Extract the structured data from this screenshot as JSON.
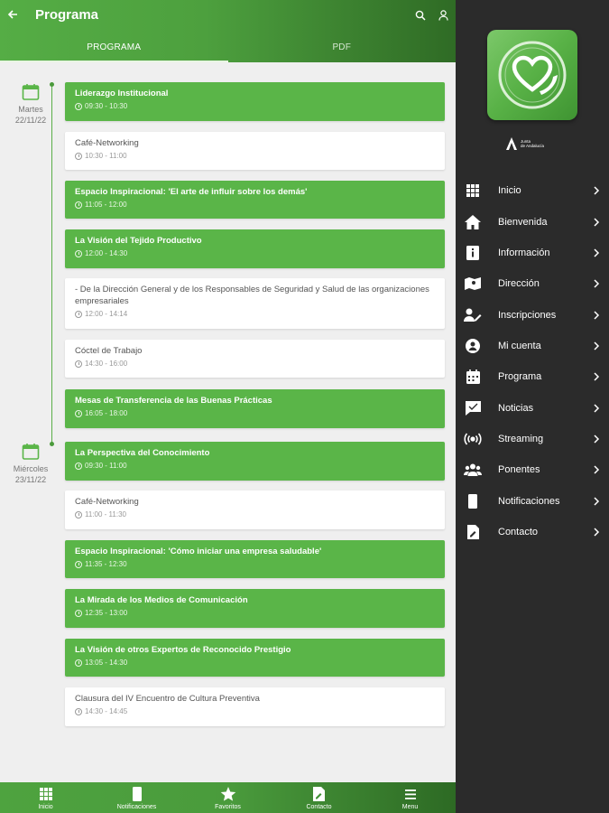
{
  "header": {
    "title": "Programa",
    "back_icon": "arrow-left-icon",
    "search_icon": "search-icon",
    "user_icon": "user-icon"
  },
  "tabs": [
    {
      "label": "PROGRAMA",
      "active": true
    },
    {
      "label": "PDF",
      "active": false
    }
  ],
  "days": [
    {
      "line1": "Martes",
      "line2": "22/11/22"
    },
    {
      "line1": "Miércoles",
      "line2": "23/11/22"
    }
  ],
  "events": [
    {
      "title": "Liderazgo Institucional",
      "time": "09:30 - 10:30",
      "style": "green"
    },
    {
      "title": "Café-Networking",
      "time": "10:30 - 11:00",
      "style": "white"
    },
    {
      "title": "Espacio Inspiracional: 'El arte de influir sobre los demás'",
      "time": "11:05 - 12:00",
      "style": "green"
    },
    {
      "title": "La Visión del Tejido Productivo",
      "time": "12:00 - 14:30",
      "style": "green"
    },
    {
      "title": "- De la Dirección General y de los Responsables de Seguridad y Salud de las organizaciones empresariales",
      "time": "12:00 - 14:14",
      "style": "white"
    },
    {
      "title": "Cóctel de Trabajo",
      "time": "14:30 - 16:00",
      "style": "white"
    },
    {
      "title": "Mesas de Transferencia de las Buenas Prácticas",
      "time": "16:05 - 18:00",
      "style": "green"
    },
    {
      "title": "La Perspectiva del Conocimiento",
      "time": "09:30 - 11:00",
      "style": "green"
    },
    {
      "title": "Café-Networking",
      "time": "11:00 - 11:30",
      "style": "white"
    },
    {
      "title": "Espacio Inspiracional: 'Cómo iniciar una empresa saludable'",
      "time": "11:35 - 12:30",
      "style": "green"
    },
    {
      "title": "La Mirada de los Medios de Comunicación",
      "time": "12:35 - 13:00",
      "style": "green"
    },
    {
      "title": "La Visión de otros Expertos de Reconocido Prestigio",
      "time": "13:05 - 14:30",
      "style": "green"
    },
    {
      "title": "Clausura del IV Encuentro de Cultura Preventiva",
      "time": "14:30 - 14:45",
      "style": "white"
    }
  ],
  "bottom_nav": [
    {
      "label": "Inicio",
      "icon": "grid-icon"
    },
    {
      "label": "Notificaciones",
      "icon": "phone-icon"
    },
    {
      "label": "Favoritos",
      "icon": "star-icon"
    },
    {
      "label": "Contacto",
      "icon": "edit-icon"
    },
    {
      "label": "Menu",
      "icon": "menu-icon"
    }
  ],
  "drawer": {
    "logo_icon": "heart-hand-icon",
    "org_logo_text": "Junta de Andalucía",
    "items": [
      {
        "label": "Inicio",
        "icon": "grid-icon"
      },
      {
        "label": "Bienvenida",
        "icon": "home-icon"
      },
      {
        "label": "Información",
        "icon": "info-icon"
      },
      {
        "label": "Dirección",
        "icon": "map-icon"
      },
      {
        "label": "Inscripciones",
        "icon": "user-edit-icon"
      },
      {
        "label": "Mi cuenta",
        "icon": "account-icon"
      },
      {
        "label": "Programa",
        "icon": "calendar-icon"
      },
      {
        "label": "Noticias",
        "icon": "chat-icon"
      },
      {
        "label": "Streaming",
        "icon": "broadcast-icon"
      },
      {
        "label": "Ponentes",
        "icon": "people-icon"
      },
      {
        "label": "Notificaciones",
        "icon": "phone-icon"
      },
      {
        "label": "Contacto",
        "icon": "edit-icon"
      }
    ]
  },
  "colors": {
    "brand_green": "#5ab548",
    "dark_green": "#2f6b25",
    "drawer_bg": "#2b2b2b",
    "content_bg": "#efefef"
  }
}
